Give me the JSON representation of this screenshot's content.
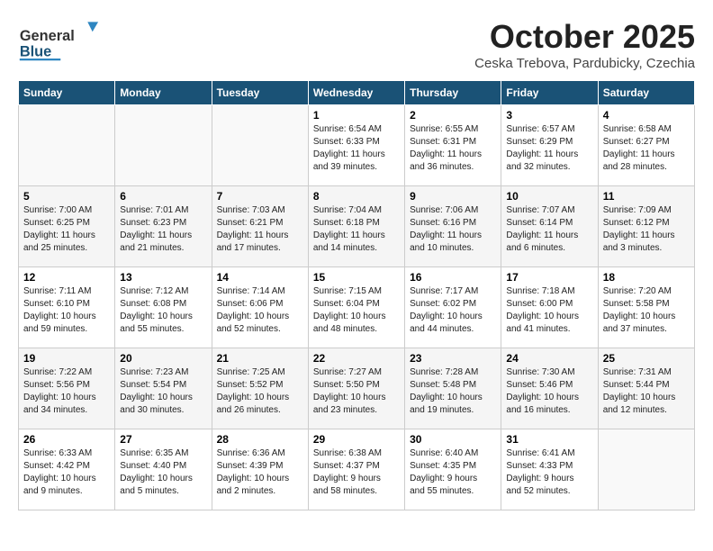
{
  "header": {
    "logo_general": "General",
    "logo_blue": "Blue",
    "month_title": "October 2025",
    "location": "Ceska Trebova, Pardubicky, Czechia"
  },
  "weekdays": [
    "Sunday",
    "Monday",
    "Tuesday",
    "Wednesday",
    "Thursday",
    "Friday",
    "Saturday"
  ],
  "weeks": [
    [
      {
        "day": "",
        "info": ""
      },
      {
        "day": "",
        "info": ""
      },
      {
        "day": "",
        "info": ""
      },
      {
        "day": "1",
        "info": "Sunrise: 6:54 AM\nSunset: 6:33 PM\nDaylight: 11 hours\nand 39 minutes."
      },
      {
        "day": "2",
        "info": "Sunrise: 6:55 AM\nSunset: 6:31 PM\nDaylight: 11 hours\nand 36 minutes."
      },
      {
        "day": "3",
        "info": "Sunrise: 6:57 AM\nSunset: 6:29 PM\nDaylight: 11 hours\nand 32 minutes."
      },
      {
        "day": "4",
        "info": "Sunrise: 6:58 AM\nSunset: 6:27 PM\nDaylight: 11 hours\nand 28 minutes."
      }
    ],
    [
      {
        "day": "5",
        "info": "Sunrise: 7:00 AM\nSunset: 6:25 PM\nDaylight: 11 hours\nand 25 minutes."
      },
      {
        "day": "6",
        "info": "Sunrise: 7:01 AM\nSunset: 6:23 PM\nDaylight: 11 hours\nand 21 minutes."
      },
      {
        "day": "7",
        "info": "Sunrise: 7:03 AM\nSunset: 6:21 PM\nDaylight: 11 hours\nand 17 minutes."
      },
      {
        "day": "8",
        "info": "Sunrise: 7:04 AM\nSunset: 6:18 PM\nDaylight: 11 hours\nand 14 minutes."
      },
      {
        "day": "9",
        "info": "Sunrise: 7:06 AM\nSunset: 6:16 PM\nDaylight: 11 hours\nand 10 minutes."
      },
      {
        "day": "10",
        "info": "Sunrise: 7:07 AM\nSunset: 6:14 PM\nDaylight: 11 hours\nand 6 minutes."
      },
      {
        "day": "11",
        "info": "Sunrise: 7:09 AM\nSunset: 6:12 PM\nDaylight: 11 hours\nand 3 minutes."
      }
    ],
    [
      {
        "day": "12",
        "info": "Sunrise: 7:11 AM\nSunset: 6:10 PM\nDaylight: 10 hours\nand 59 minutes."
      },
      {
        "day": "13",
        "info": "Sunrise: 7:12 AM\nSunset: 6:08 PM\nDaylight: 10 hours\nand 55 minutes."
      },
      {
        "day": "14",
        "info": "Sunrise: 7:14 AM\nSunset: 6:06 PM\nDaylight: 10 hours\nand 52 minutes."
      },
      {
        "day": "15",
        "info": "Sunrise: 7:15 AM\nSunset: 6:04 PM\nDaylight: 10 hours\nand 48 minutes."
      },
      {
        "day": "16",
        "info": "Sunrise: 7:17 AM\nSunset: 6:02 PM\nDaylight: 10 hours\nand 44 minutes."
      },
      {
        "day": "17",
        "info": "Sunrise: 7:18 AM\nSunset: 6:00 PM\nDaylight: 10 hours\nand 41 minutes."
      },
      {
        "day": "18",
        "info": "Sunrise: 7:20 AM\nSunset: 5:58 PM\nDaylight: 10 hours\nand 37 minutes."
      }
    ],
    [
      {
        "day": "19",
        "info": "Sunrise: 7:22 AM\nSunset: 5:56 PM\nDaylight: 10 hours\nand 34 minutes."
      },
      {
        "day": "20",
        "info": "Sunrise: 7:23 AM\nSunset: 5:54 PM\nDaylight: 10 hours\nand 30 minutes."
      },
      {
        "day": "21",
        "info": "Sunrise: 7:25 AM\nSunset: 5:52 PM\nDaylight: 10 hours\nand 26 minutes."
      },
      {
        "day": "22",
        "info": "Sunrise: 7:27 AM\nSunset: 5:50 PM\nDaylight: 10 hours\nand 23 minutes."
      },
      {
        "day": "23",
        "info": "Sunrise: 7:28 AM\nSunset: 5:48 PM\nDaylight: 10 hours\nand 19 minutes."
      },
      {
        "day": "24",
        "info": "Sunrise: 7:30 AM\nSunset: 5:46 PM\nDaylight: 10 hours\nand 16 minutes."
      },
      {
        "day": "25",
        "info": "Sunrise: 7:31 AM\nSunset: 5:44 PM\nDaylight: 10 hours\nand 12 minutes."
      }
    ],
    [
      {
        "day": "26",
        "info": "Sunrise: 6:33 AM\nSunset: 4:42 PM\nDaylight: 10 hours\nand 9 minutes."
      },
      {
        "day": "27",
        "info": "Sunrise: 6:35 AM\nSunset: 4:40 PM\nDaylight: 10 hours\nand 5 minutes."
      },
      {
        "day": "28",
        "info": "Sunrise: 6:36 AM\nSunset: 4:39 PM\nDaylight: 10 hours\nand 2 minutes."
      },
      {
        "day": "29",
        "info": "Sunrise: 6:38 AM\nSunset: 4:37 PM\nDaylight: 9 hours\nand 58 minutes."
      },
      {
        "day": "30",
        "info": "Sunrise: 6:40 AM\nSunset: 4:35 PM\nDaylight: 9 hours\nand 55 minutes."
      },
      {
        "day": "31",
        "info": "Sunrise: 6:41 AM\nSunset: 4:33 PM\nDaylight: 9 hours\nand 52 minutes."
      },
      {
        "day": "",
        "info": ""
      }
    ]
  ]
}
